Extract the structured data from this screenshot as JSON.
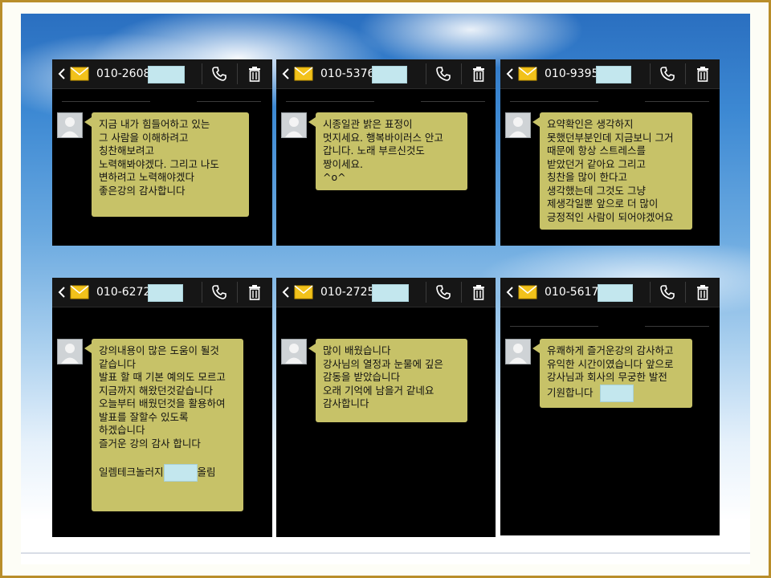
{
  "panels": [
    {
      "number": "010-2608-",
      "lines": [
        "지금 내가  힘들어하고 있는",
        "그 사람을 이해하려고",
        "칭찬해보려고",
        "노력해봐야겠다.  그리고  나도",
        "변하려고 노력해야겠다",
        "좋은강의  감사합니다"
      ]
    },
    {
      "number": "010-5376-",
      "lines": [
        "시종일관 밝은 표정이",
        "멋지세요. 행복바이러스 안고",
        "갑니다. 노래 부르신것도",
        "짱이세요.",
        "^o^"
      ]
    },
    {
      "number": "010-9395-",
      "lines": [
        "요약확인은 생각하지",
        "못했던부분인데 지금보니 그거",
        "때문에 항상 스트레스를",
        "받았던거 같아요 그리고",
        "칭찬을 많이 한다고",
        "생각했는데 그것도 그냥",
        "제생각일뿐 앞으로 더 많이",
        "긍정적인 사람이 되어야겠어요"
      ]
    },
    {
      "number": "010-6272-",
      "lines": [
        "강의내용이 많은 도움이 될것",
        "같습니다",
        "발표 할 때 기본 예의도 모르고",
        "지금까지 해왔던것같습니다",
        "오늘부터 배웠던것을 활용하여",
        "발표를 잘할수 있도록",
        "하겠습니다",
        "즐거운 강의 감사 합니다",
        ""
      ],
      "sign_prefix": "일렘테크놀러지",
      "sign_suffix": "올림"
    },
    {
      "number": "010-2725-",
      "lines": [
        "많이 배웠습니다",
        "강사님의 열정과 눈물에 깊은",
        "감동을 받았습니다",
        "오래 기억에 남을거 같네요",
        "감사합니다"
      ]
    },
    {
      "number": "010-5617-",
      "lines": [
        "유쾌하게 즐거운강의 감사하고",
        "유익한 시간이였습니다 앞으로",
        "강사님과 회사의 무궁한 발전"
      ],
      "last_prefix": "기원합니다"
    }
  ],
  "icons": {
    "back": "chevron-left-icon",
    "message": "envelope-icon",
    "call": "phone-icon",
    "delete": "trash-icon"
  },
  "colors": {
    "bubble": "#c7c268",
    "mask": "#c3e7ee",
    "envelope": "#f2c21b"
  }
}
